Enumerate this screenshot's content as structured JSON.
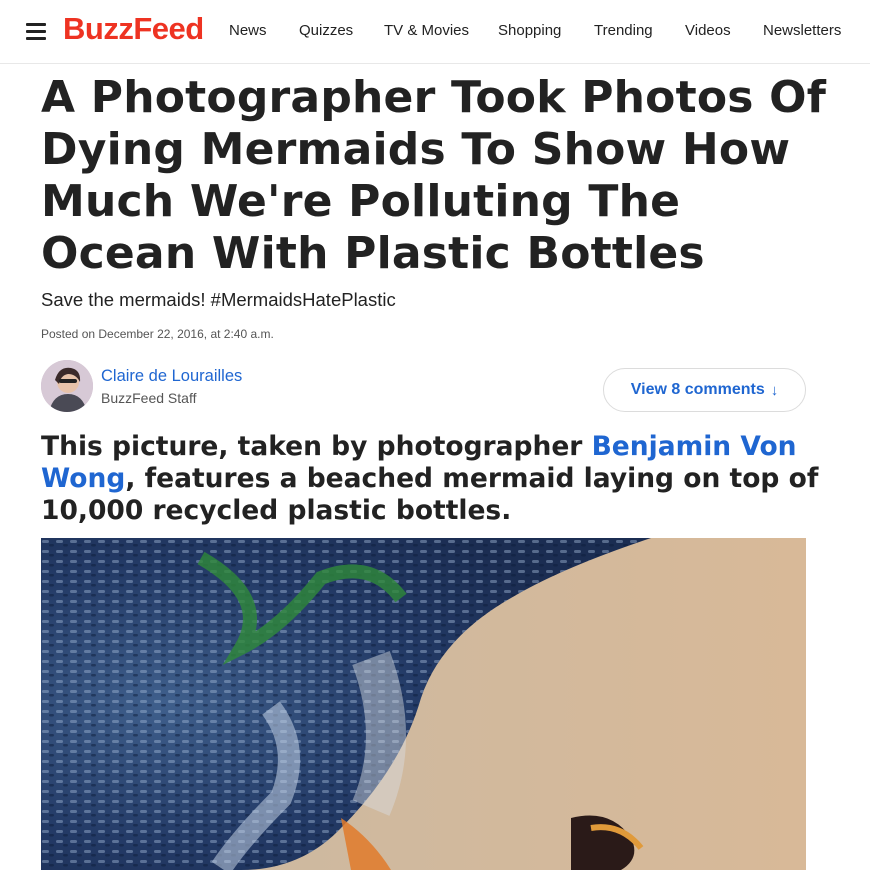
{
  "header": {
    "logo": "BuzzFeed",
    "nav": [
      "News",
      "Quizzes",
      "TV & Movies",
      "Shopping",
      "Trending",
      "Videos",
      "Newsletters"
    ]
  },
  "article": {
    "headline": "A Photographer Took Photos Of Dying Mermaids To Show How Much We're Polluting The Ocean With Plastic Bottles",
    "dek": "Save the mermaids! #MermaidsHatePlastic",
    "posted": "Posted on December 22, 2016, at 2:40 a.m.",
    "author": {
      "name": "Claire de Lourailles",
      "role": "BuzzFeed Staff"
    },
    "comments_label": "View 8 comments",
    "subhead_before": "This picture, taken by photographer ",
    "subhead_link": "Benjamin Von Wong",
    "subhead_after": ", features a beached mermaid laying on top of 10,000 recycled plastic bottles."
  },
  "colors": {
    "brand": "#ee3322",
    "link": "#1f66d1"
  }
}
